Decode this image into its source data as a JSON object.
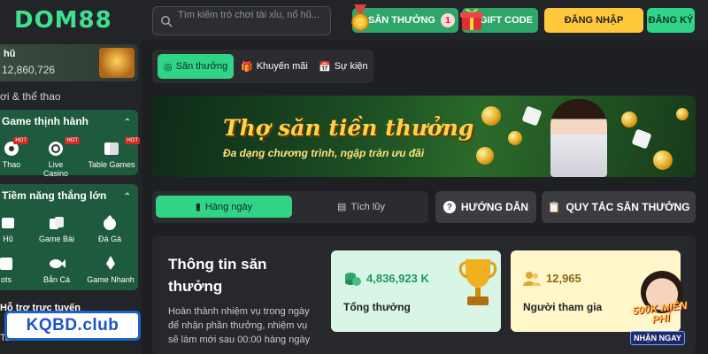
{
  "header": {
    "logo": "DOM88",
    "search_placeholder": "Tìm kiếm trò chơi tài xỉu, nổ hũ...",
    "prize_label": "SĂN THƯỞNG",
    "prize_count": "1",
    "gift_label": "GIFT CODE",
    "login_label": "ĐĂNG NHẬP",
    "register_label": "ĐĂNG KÝ"
  },
  "sidebar": {
    "jackpot_label": "hũ",
    "jackpot_value": "12,860,726",
    "section_title": "ơi & thể thao",
    "hot_group": {
      "title": "Game thịnh hành",
      "items": [
        {
          "label": "Thao",
          "hot": "HOT"
        },
        {
          "label": "Live Casino",
          "hot": "HOT"
        },
        {
          "label": "Table Games",
          "hot": "HOT"
        }
      ]
    },
    "potential_group": {
      "title": "Tiềm năng thắng lớn",
      "items": [
        {
          "label": "Hũ"
        },
        {
          "label": "Game Bài"
        },
        {
          "label": "Đá Gà"
        },
        {
          "label": "ots"
        },
        {
          "label": "Bắn Cá"
        },
        {
          "label": "Game Nhanh"
        }
      ]
    },
    "support_label": "Hỗ trợ trực tuyến",
    "support_sub": "Tele",
    "watermark": "KQBD.club"
  },
  "main": {
    "tabs": [
      {
        "label": "Săn thưởng"
      },
      {
        "label": "Khuyến mãi"
      },
      {
        "label": "Sự kiện"
      }
    ],
    "banner": {
      "title": "Thợ săn tiền thưởng",
      "subtitle": "Đa dạng chương trình, ngập tràn ưu đãi"
    },
    "period_tabs": [
      {
        "label": "Hàng ngày"
      },
      {
        "label": "Tích lũy"
      }
    ],
    "guide_label": "HƯỚNG DẪN",
    "rules_label": "QUY TẮC SĂN THƯỞNG",
    "info": {
      "title": "Thông tin săn thưởng",
      "desc": "Hoàn thành nhiệm vụ trong ngày để nhận phần thưởng, nhiệm vụ sẽ làm mới sau 00:00 hàng ngày"
    },
    "stats": {
      "total_value": "4,836,923 K",
      "total_label": "Tổng thưởng",
      "people_value": "12,965",
      "people_label": "Người tham gia"
    },
    "promo": {
      "free_text": "500K MIỄN PHÍ",
      "button": "NHẬN NGAY"
    }
  }
}
